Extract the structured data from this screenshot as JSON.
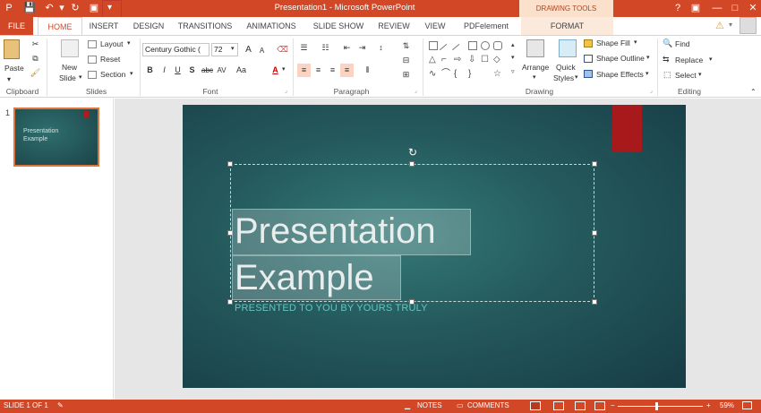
{
  "title_bar": {
    "app_title": "Presentation1 - Microsoft PowerPoint",
    "tools_band": "DRAWING TOOLS",
    "help": "?",
    "restore": "▣",
    "minimize": "—",
    "maximize": "□",
    "close": "✕"
  },
  "tabs": [
    {
      "label": "FILE"
    },
    {
      "label": "HOME"
    },
    {
      "label": "INSERT"
    },
    {
      "label": "DESIGN"
    },
    {
      "label": "TRANSITIONS"
    },
    {
      "label": "ANIMATIONS"
    },
    {
      "label": "SLIDE SHOW"
    },
    {
      "label": "REVIEW"
    },
    {
      "label": "VIEW"
    },
    {
      "label": "PDFelement"
    },
    {
      "label": "FORMAT"
    }
  ],
  "ribbon": {
    "clipboard": {
      "label": "Clipboard",
      "paste": "Paste"
    },
    "slides": {
      "label": "Slides",
      "new_slide": "New",
      "new_slide2": "Slide",
      "layout": "Layout",
      "reset": "Reset",
      "section": "Section"
    },
    "font": {
      "label": "Font",
      "font_name": "Century Gothic (",
      "font_size": "72"
    },
    "paragraph": {
      "label": "Paragraph"
    },
    "drawing": {
      "label": "Drawing",
      "arrange": "Arrange",
      "quick_styles": "Quick",
      "quick_styles2": "Styles",
      "shape_fill": "Shape Fill",
      "shape_outline": "Shape Outline",
      "shape_effects": "Shape Effects"
    },
    "editing": {
      "label": "Editing",
      "find": "Find",
      "replace": "Replace",
      "select": "Select"
    }
  },
  "thumbnail": {
    "number": "1",
    "line1": "Presentation",
    "line2": "Example"
  },
  "slide": {
    "title_line1": "Presentation",
    "title_line2": "Example",
    "subtitle": "PRESENTED TO YOU BY YOURS TRULY"
  },
  "status": {
    "slide_of": "SLIDE 1 OF 1",
    "notes": "NOTES",
    "comments": "COMMENTS",
    "zoom": "59%"
  },
  "colors": {
    "accent": "#d24726",
    "slide_bg": "#24595c",
    "bookmark": "#a8191b",
    "subtitle": "#63c5c0"
  }
}
